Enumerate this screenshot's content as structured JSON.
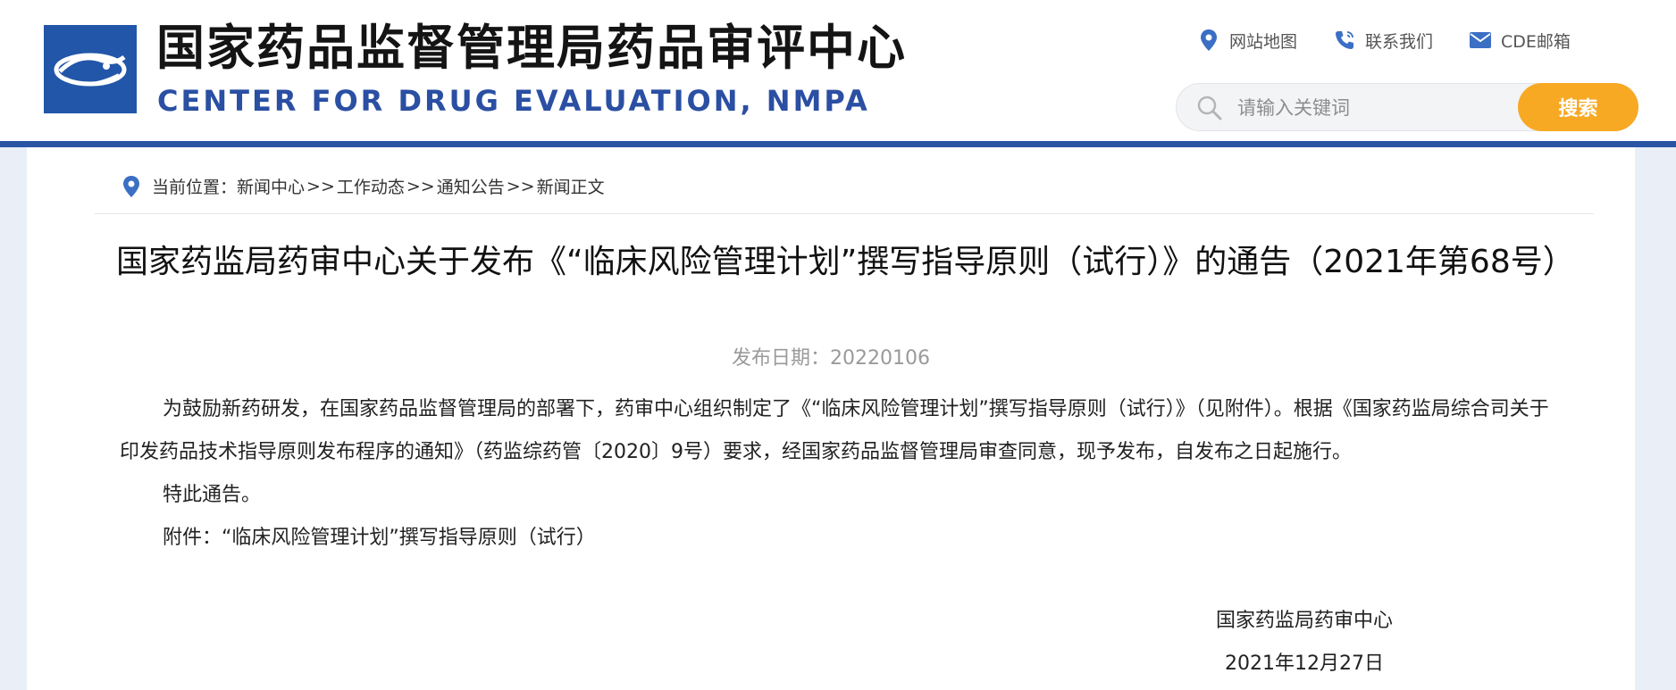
{
  "header": {
    "title": "国家药品监督管理局药品审评中心",
    "subtitle": "CENTER FOR DRUG EVALUATION, NMPA",
    "links": [
      {
        "label": "网站地图",
        "icon": "location-pin-icon"
      },
      {
        "label": "联系我们",
        "icon": "phone-icon"
      },
      {
        "label": "CDE邮箱",
        "icon": "mail-icon"
      }
    ],
    "search": {
      "placeholder": "请输入关键词",
      "value": "",
      "button_label": "搜索"
    },
    "colors": {
      "brand_blue": "#2a55a4",
      "search_button": "#f7a924"
    }
  },
  "breadcrumb": {
    "prefix": "当前位置：",
    "items": [
      "新闻中心",
      "工作动态",
      "通知公告",
      "新闻正文"
    ],
    "separator": ">>"
  },
  "article": {
    "title": "国家药监局药审中心关于发布《“临床风险管理计划”撰写指导原则（试行）》的通告（2021年第68号）",
    "date_label": "发布日期：20220106",
    "paragraphs": [
      "为鼓励新药研发，在国家药品监督管理局的部署下，药审中心组织制定了《“临床风险管理计划”撰写指导原则（试行）》（见附件）。根据《国家药监局综合司关于印发药品技术指导原则发布程序的通知》（药监综药管〔2020〕9号）要求，经国家药品监督管理局审查同意，现予发布，自发布之日起施行。",
      "特此通告。"
    ],
    "attachment_label": "附件：",
    "attachment_link": "“临床风险管理计划”撰写指导原则（试行）",
    "signature_org": "国家药监局药审中心",
    "signature_date": "2021年12月27日"
  }
}
